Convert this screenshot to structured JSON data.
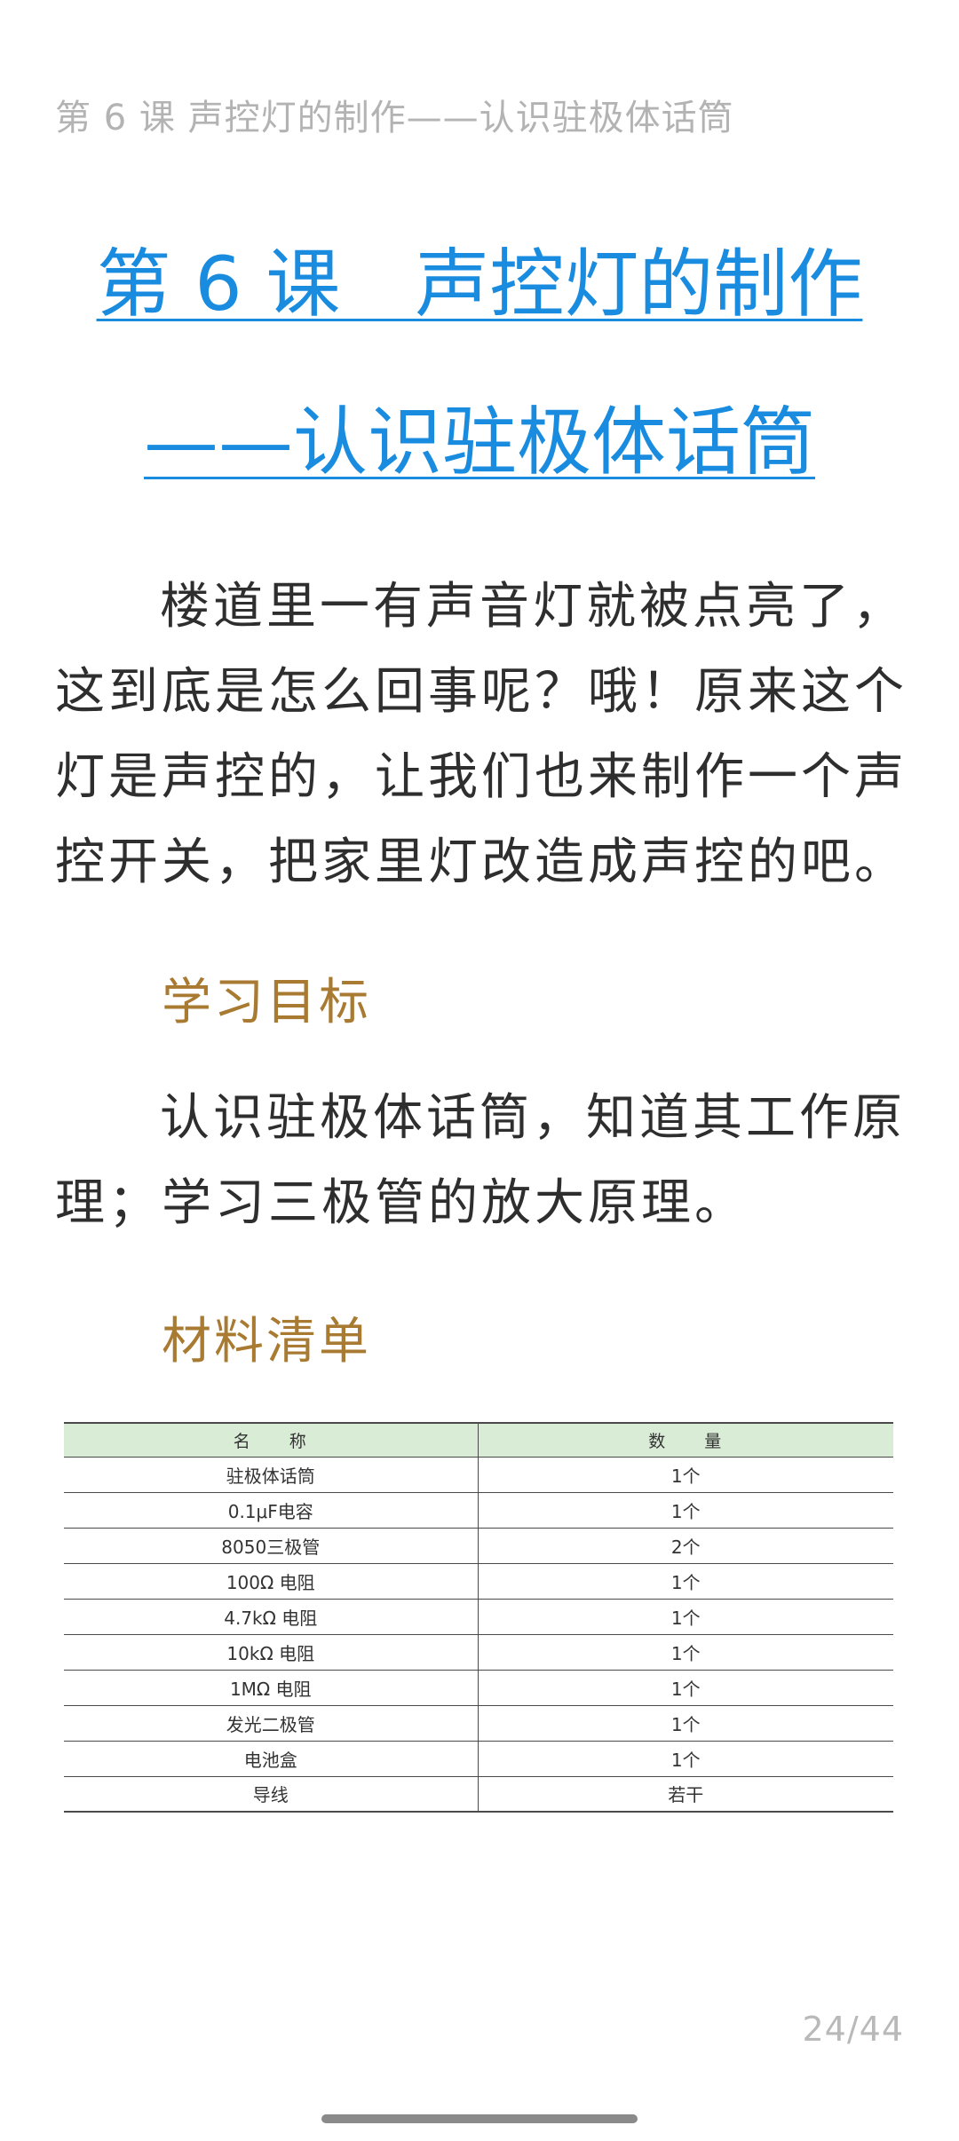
{
  "header": {
    "running_title": "第 6 课 声控灯的制作——认识驻极体话筒"
  },
  "lesson": {
    "title_line_1": "第 6 课　声控灯的制作",
    "title_line_2": "——认识驻极体话筒"
  },
  "intro": {
    "text": "楼道里一有声音灯就被点亮了，这到底是怎么回事呢？哦！原来这个灯是声控的，让我们也来制作一个声控开关，把家里灯改造成声控的吧。"
  },
  "objectives": {
    "heading": "学习目标",
    "text": "认识驻极体话筒，知道其工作原理；学习三极管的放大原理。"
  },
  "materials": {
    "heading": "材料清单",
    "columns": [
      "名　　称",
      "数　　量"
    ],
    "rows": [
      [
        "驻极体话筒",
        "1个"
      ],
      [
        "0.1μF电容",
        "1个"
      ],
      [
        "8050三极管",
        "2个"
      ],
      [
        "100Ω 电阻",
        "1个"
      ],
      [
        "4.7kΩ 电阻",
        "1个"
      ],
      [
        "10kΩ 电阻",
        "1个"
      ],
      [
        "1MΩ 电阻",
        "1个"
      ],
      [
        "发光二极管",
        "1个"
      ],
      [
        "电池盒",
        "1个"
      ],
      [
        "导线",
        "若干"
      ]
    ]
  },
  "footer": {
    "page_indicator": "24/44"
  },
  "colors": {
    "title_blue": "#1a8ce0",
    "heading_brown": "#a87a32",
    "table_header_green": "#d9ecd6"
  }
}
